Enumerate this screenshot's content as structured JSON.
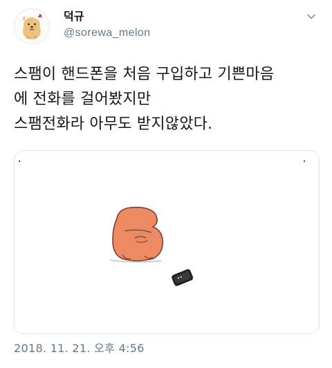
{
  "tweet": {
    "display_name": "덕규",
    "handle": "@sorewa_melon",
    "text_lines": [
      "스팸이 핸드폰을 처음 구입하고 기쁜마음",
      "에 전화를 걸어봤지만",
      "스팸전화라 아무도 받지않았다."
    ],
    "timestamp": "2018. 11. 21. 오후 4:56"
  },
  "icons": {
    "avatar": "dog-character-avatar-icon",
    "menu": "chevron-down-icon"
  },
  "colors": {
    "text_primary": "#14171a",
    "text_secondary": "#657786",
    "border": "#e1e8ed"
  }
}
